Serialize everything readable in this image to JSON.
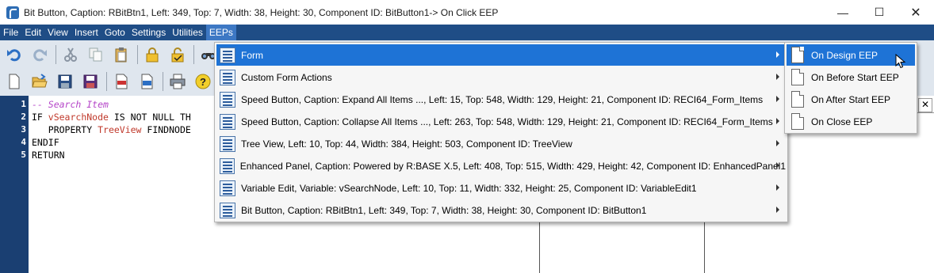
{
  "window": {
    "title": "Bit Button, Caption: RBitBtn1, Left: 349, Top: 7, Width: 38, Height: 30, Component ID: BitButton1-> On Click EEP",
    "minimize_glyph": "—",
    "maximize_glyph": "☐",
    "close_glyph": "✕"
  },
  "menubar": {
    "items": [
      "File",
      "Edit",
      "View",
      "Insert",
      "Goto",
      "Settings",
      "Utilities",
      "EEPs"
    ],
    "active": "EEPs"
  },
  "toolbar": {
    "row1_icons": [
      "undo-icon",
      "redo-icon",
      "cut-icon",
      "copy-icon",
      "paste-icon",
      "lock-icon",
      "unlock-icon",
      "find-icon"
    ],
    "row2_icons": [
      "new-file-icon",
      "open-folder-icon",
      "save-icon",
      "save-as-icon",
      "export-rtf-icon",
      "export-html-icon",
      "print-icon",
      "help-icon"
    ]
  },
  "editor": {
    "lines": [
      {
        "no": "1",
        "segments": [
          {
            "t": "-- Search Item",
            "c": "comment"
          }
        ]
      },
      {
        "no": "2",
        "segments": [
          {
            "t": "IF ",
            "c": ""
          },
          {
            "t": "vSearchNode",
            "c": "var"
          },
          {
            "t": " IS NOT NULL TH",
            "c": ""
          }
        ]
      },
      {
        "no": "3",
        "segments": [
          {
            "t": "   PROPERTY ",
            "c": ""
          },
          {
            "t": "TreeView",
            "c": "var"
          },
          {
            "t": " FINDNODE",
            "c": ""
          }
        ]
      },
      {
        "no": "4",
        "segments": [
          {
            "t": "ENDIF",
            "c": ""
          }
        ]
      },
      {
        "no": "5",
        "segments": [
          {
            "t": "RETURN",
            "c": ""
          }
        ]
      }
    ]
  },
  "right_panel": {
    "close_glyph": "✕"
  },
  "eeps_menu": {
    "items": [
      "Form",
      "Custom Form Actions",
      "Speed Button, Caption: Expand All Items ..., Left: 15, Top: 548, Width: 129, Height: 21, Component ID: RECI64_Form_Items",
      "Speed Button, Caption: Collapse All Items ..., Left: 263, Top: 548, Width: 129, Height: 21, Component ID: RECI64_Form_Items",
      "Tree View, Left: 10, Top: 44, Width: 384, Height: 503, Component ID: TreeView",
      "Enhanced Panel, Caption: Powered by R:BASE X.5, Left: 408, Top: 515, Width: 429, Height: 42, Component ID: EnhancedPanel1",
      "Variable Edit, Variable: vSearchNode, Left: 10, Top: 11, Width: 332, Height: 25, Component ID: VariableEdit1",
      "Bit Button, Caption: RBitBtn1, Left: 349, Top: 7, Width: 38, Height: 30, Component ID: BitButton1"
    ],
    "highlighted_index": 0
  },
  "form_submenu": {
    "items": [
      "On Design EEP",
      "On Before Start EEP",
      "On After Start EEP",
      "On Close EEP"
    ],
    "highlighted_index": 0
  },
  "colors": {
    "menubar": "#1f4d86",
    "highlight": "#1e73d6",
    "gutter": "#1a3f72",
    "comment": "#b545c8",
    "variable": "#c0392b"
  }
}
